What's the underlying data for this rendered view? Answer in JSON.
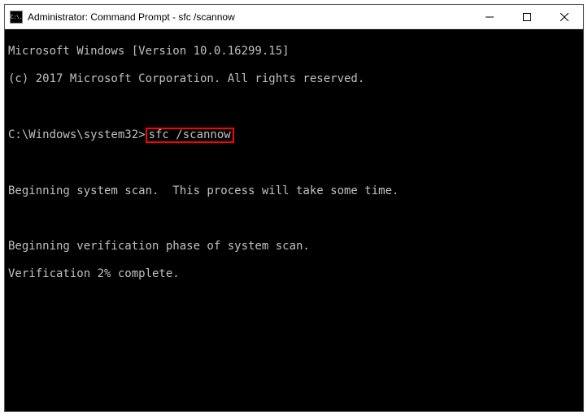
{
  "window": {
    "title": "Administrator: Command Prompt - sfc  /scannow",
    "icon_text": "C:\\."
  },
  "terminal": {
    "version_line": "Microsoft Windows [Version 10.0.16299.15]",
    "copyright_line": "(c) 2017 Microsoft Corporation. All rights reserved.",
    "prompt_prefix": "C:\\Windows\\system32>",
    "command": "sfc /scannow",
    "blank": " ",
    "begin_scan": "Beginning system scan.  This process will take some time.",
    "begin_verify": "Beginning verification phase of system scan.",
    "progress": "Verification 2% complete."
  }
}
